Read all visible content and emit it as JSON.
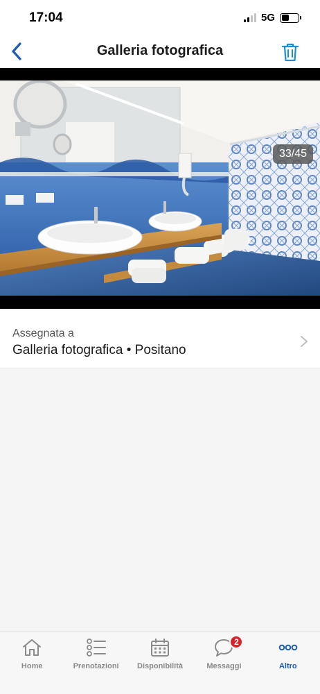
{
  "status_bar": {
    "time": "17:04",
    "network": "5G",
    "signal_bars_active": 2,
    "battery_level": 0.45
  },
  "nav": {
    "title": "Galleria fotografica",
    "back_icon": "chevron-left-icon",
    "trash_icon": "trash-icon"
  },
  "gallery": {
    "counter": "33/45",
    "photo_subject": "bathroom-photo"
  },
  "assignment": {
    "label": "Assegnata a",
    "value": "Galleria fotografica • Positano"
  },
  "tabs": [
    {
      "label": "Home",
      "icon": "home-icon",
      "active": false
    },
    {
      "label": "Prenotazioni",
      "icon": "list-icon",
      "active": false
    },
    {
      "label": "Disponibilità",
      "icon": "calendar-icon",
      "active": false
    },
    {
      "label": "Messaggi",
      "icon": "chat-icon",
      "active": false,
      "badge": "2"
    },
    {
      "label": "Altro",
      "icon": "more-icon",
      "active": true
    }
  ],
  "colors": {
    "accent": "#1a5bb5",
    "badge": "#d8232a",
    "background": "#f5f5f5"
  }
}
